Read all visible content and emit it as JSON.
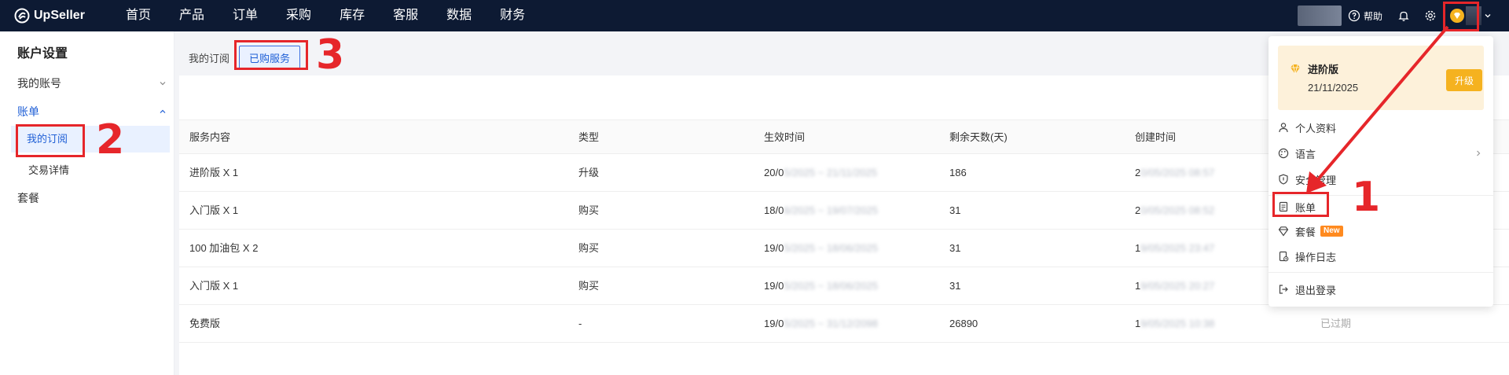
{
  "brand": {
    "name": "UpSeller"
  },
  "nav": [
    "首页",
    "产品",
    "订单",
    "采购",
    "库存",
    "客服",
    "数据",
    "财务"
  ],
  "topbar": {
    "help_label": "帮助"
  },
  "sidebar": {
    "title": "账户设置",
    "groups": [
      {
        "label": "我的账号"
      },
      {
        "label": "账单",
        "children": [
          "我的订阅",
          "交易详情"
        ]
      },
      {
        "label": "套餐"
      }
    ]
  },
  "tabs": [
    "我的订阅",
    "已购服务"
  ],
  "table": {
    "columns": [
      "服务内容",
      "类型",
      "生效时间",
      "剩余天数(天)",
      "创建时间"
    ],
    "rows": [
      {
        "service": "进阶版 X 1",
        "type": "升级",
        "period_visible": "20/0",
        "period_hidden": "5/2025 ~ 21/11/2025",
        "days": "186",
        "created_visible": "2",
        "created_hidden": "0/05/2025 08:57",
        "status": ""
      },
      {
        "service": "入门版 X 1",
        "type": "购买",
        "period_visible": "18/0",
        "period_hidden": "6/2025 ~ 19/07/2025",
        "days": "31",
        "created_visible": "2",
        "created_hidden": "0/05/2025 08:52",
        "status": ""
      },
      {
        "service": "100 加油包 X 2",
        "type": "购买",
        "period_visible": "19/0",
        "period_hidden": "5/2025 ~ 18/06/2025",
        "days": "31",
        "created_visible": "1",
        "created_hidden": "9/05/2025 23:47",
        "status": ""
      },
      {
        "service": "入门版 X 1",
        "type": "购买",
        "period_visible": "19/0",
        "period_hidden": "5/2025 ~ 18/06/2025",
        "days": "31",
        "created_visible": "1",
        "created_hidden": "9/05/2025 20:27",
        "status": ""
      },
      {
        "service": "免费版",
        "type": "-",
        "period_visible": "19/0",
        "period_hidden": "5/2025 ~ 31/12/2098",
        "days": "26890",
        "created_visible": "1",
        "created_hidden": "9/05/2025 10:38",
        "status": "已过期"
      }
    ]
  },
  "dropdown": {
    "plan_name": "进阶版",
    "plan_expiry": "21/11/2025",
    "upgrade_label": "升级",
    "items": [
      {
        "label": "个人资料",
        "icon": "user-icon"
      },
      {
        "label": "语言",
        "icon": "palette-icon"
      },
      {
        "label": "安全管理",
        "icon": "shield-icon"
      },
      {
        "label": "账单",
        "icon": "bill-icon"
      },
      {
        "label": "套餐",
        "icon": "diamond-icon",
        "badge": "New"
      },
      {
        "label": "操作日志",
        "icon": "log-icon"
      },
      {
        "label": "退出登录",
        "icon": "logout-icon"
      }
    ]
  },
  "annotations": [
    "1",
    "2",
    "3"
  ],
  "colors": {
    "topbar": "#0d1a33",
    "accent": "#1f5fd6",
    "annotation": "#e6262a",
    "gold": "#f5b21f",
    "badge": "#ff8a1f"
  }
}
